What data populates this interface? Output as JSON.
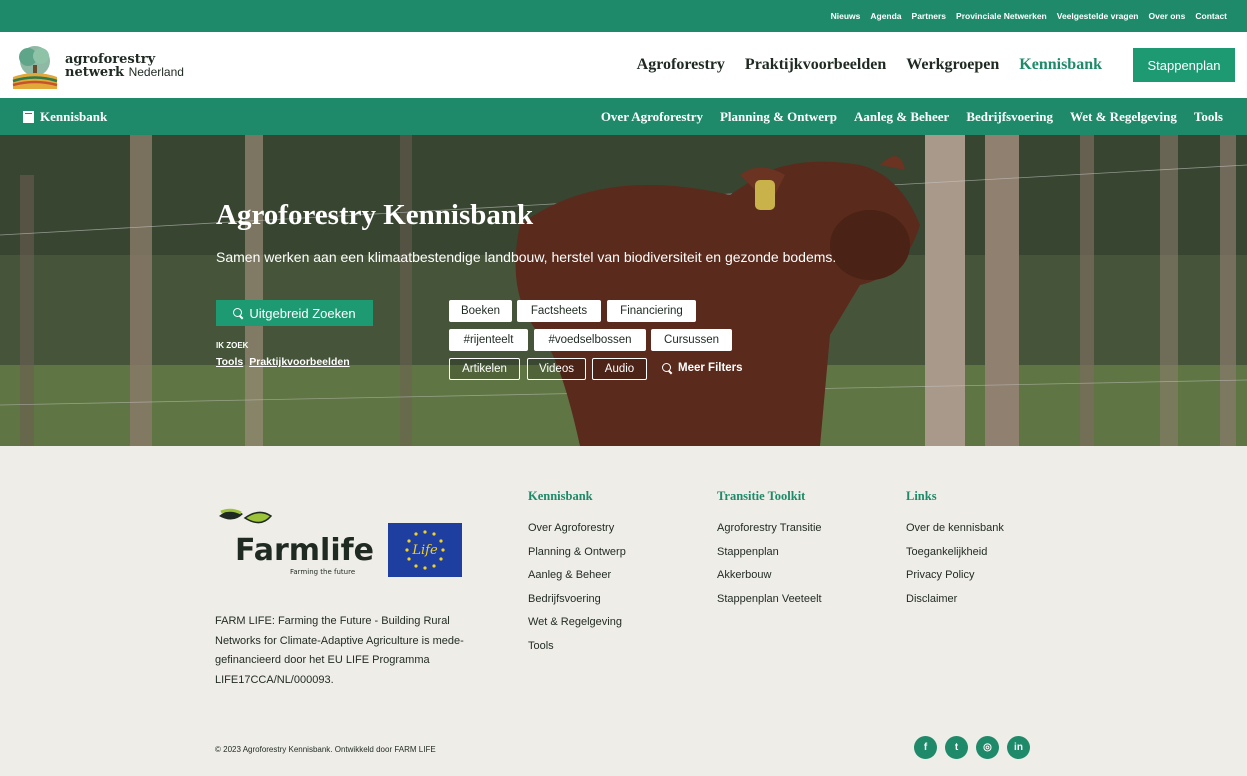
{
  "topbar": {
    "links": [
      "Nieuws",
      "Agenda",
      "Partners",
      "Provinciale Netwerken",
      "Veelgestelde vragen",
      "Over ons",
      "Contact"
    ]
  },
  "header": {
    "logo_line1": "agroforestry",
    "logo_line2": "netwerk",
    "logo_line2_suffix": "Nederland",
    "nav": [
      {
        "label": "Agroforestry"
      },
      {
        "label": "Praktijkvoorbeelden"
      },
      {
        "label": "Werkgroepen"
      },
      {
        "label": "Kennisbank",
        "active": true
      }
    ],
    "cta": "Stappenplan"
  },
  "subnav": {
    "home_label": "Kennisbank",
    "items": [
      "Over Agroforestry",
      "Planning & Ontwerp",
      "Aanleg & Beheer",
      "Bedrijfsvoering",
      "Wet & Regelgeving",
      "Tools"
    ]
  },
  "hero": {
    "title": "Agroforestry Kennisbank",
    "subtitle": "Samen werken aan een klimaatbestendige landbouw, herstel van biodiversiteit en gezonde bodems.",
    "search_button": "Uitgebreid Zoeken",
    "ikzoek_label": "IK ZOEK",
    "ikzoek_links": [
      "Tools",
      "Praktijkvoorbeelden"
    ],
    "tags_row1": [
      "Boeken",
      "Factsheets",
      "Financiering"
    ],
    "tags_row2": [
      "#rijenteelt",
      "#voedselbossen",
      "Cursussen"
    ],
    "tags_row3": [
      "Artikelen",
      "Videos",
      "Audio"
    ],
    "more_filters": "Meer Filters"
  },
  "footer": {
    "farmlife_logo_text": "Farmlife",
    "farmlife_tagline": "Farming the future",
    "eu_logo_text": "Life",
    "description": "FARM LIFE: Farming the Future - Building Rural Networks for Climate-Adaptive Agriculture is mede-gefinancieerd door het EU LIFE Programma LIFE17CCA/NL/000093.",
    "columns": [
      {
        "title": "Kennisbank",
        "links": [
          "Over Agroforestry",
          "Planning & Ontwerp",
          "Aanleg & Beheer",
          "Bedrijfsvoering",
          "Wet & Regelgeving",
          "Tools"
        ]
      },
      {
        "title": "Transitie Toolkit",
        "links": [
          "Agroforestry Transitie",
          "Stappenplan",
          "Akkerbouw",
          "Stappenplan Veeteelt"
        ]
      },
      {
        "title": "Links",
        "links": [
          "Over de kennisbank",
          "Toegankelijkheid",
          "Privacy Policy",
          "Disclaimer"
        ]
      }
    ],
    "copyright": "© 2023 Agroforestry Kennisbank. Ontwikkeld door FARM LIFE",
    "social": [
      {
        "icon": "facebook-icon",
        "glyph": "f"
      },
      {
        "icon": "twitter-icon",
        "glyph": "t"
      },
      {
        "icon": "instagram-icon",
        "glyph": "◎"
      },
      {
        "icon": "linkedin-icon",
        "glyph": "in"
      }
    ]
  },
  "colors": {
    "brand_green": "#1e8a6a",
    "button_green": "#1e9a73",
    "footer_bg": "#efede8"
  }
}
